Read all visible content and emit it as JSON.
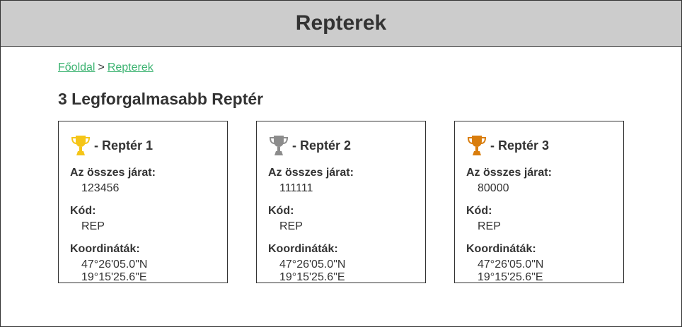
{
  "header": {
    "title": "Repterek"
  },
  "breadcrumb": {
    "home": "Főoldal",
    "separator": ">",
    "current": "Repterek"
  },
  "section": {
    "title": "3 Legforgalmasabb Reptér"
  },
  "labels": {
    "flights": "Az összes járat:",
    "code": "Kód:",
    "coords": "Koordináták:"
  },
  "airports": [
    {
      "title": "- Reptér 1",
      "trophy": "gold-trophy-icon",
      "trophy_color": "#f5c518",
      "flights": "123456",
      "code": "REP",
      "coords": "47°26'05.0\"N 19°15'25.6\"E"
    },
    {
      "title": "- Reptér 2",
      "trophy": "silver-trophy-icon",
      "trophy_color": "#8c8c8c",
      "flights": "111111",
      "code": "REP",
      "coords": "47°26'05.0\"N 19°15'25.6\"E"
    },
    {
      "title": "- Reptér 3",
      "trophy": "bronze-trophy-icon",
      "trophy_color": "#d97d0d",
      "flights": "80000",
      "code": "REP",
      "coords": "47°26'05.0\"N 19°15'25.6\"E"
    }
  ]
}
